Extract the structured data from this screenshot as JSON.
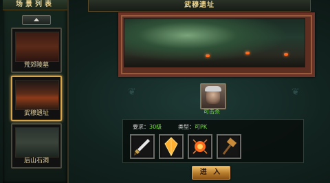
{
  "scene_list": {
    "title": "场景列表",
    "scroll_up_icon": "up-arrow-icon",
    "items": [
      {
        "label": "荒郊陵墓",
        "selected": false
      },
      {
        "label": "武穆遗址",
        "selected": true
      },
      {
        "label": "后山石洞",
        "selected": false
      }
    ]
  },
  "header": {
    "title": "武穆遗址"
  },
  "boss": {
    "status": "可击杀",
    "portrait_icon": "bearded-warrior-portrait"
  },
  "info": {
    "req_label": "要求：",
    "req_value": "30级",
    "type_label": "类型：",
    "type_value": "可PK",
    "rewards": [
      {
        "icon": "dagger-icon"
      },
      {
        "icon": "orange-crystal-icon"
      },
      {
        "icon": "fire-gem-icon"
      },
      {
        "icon": "hammer-icon"
      }
    ]
  },
  "enter_button": {
    "label": "进 入"
  },
  "colors": {
    "gold_text": "#ead38e",
    "green_text": "#7ee04c",
    "selected_border": "#d9a54a"
  }
}
